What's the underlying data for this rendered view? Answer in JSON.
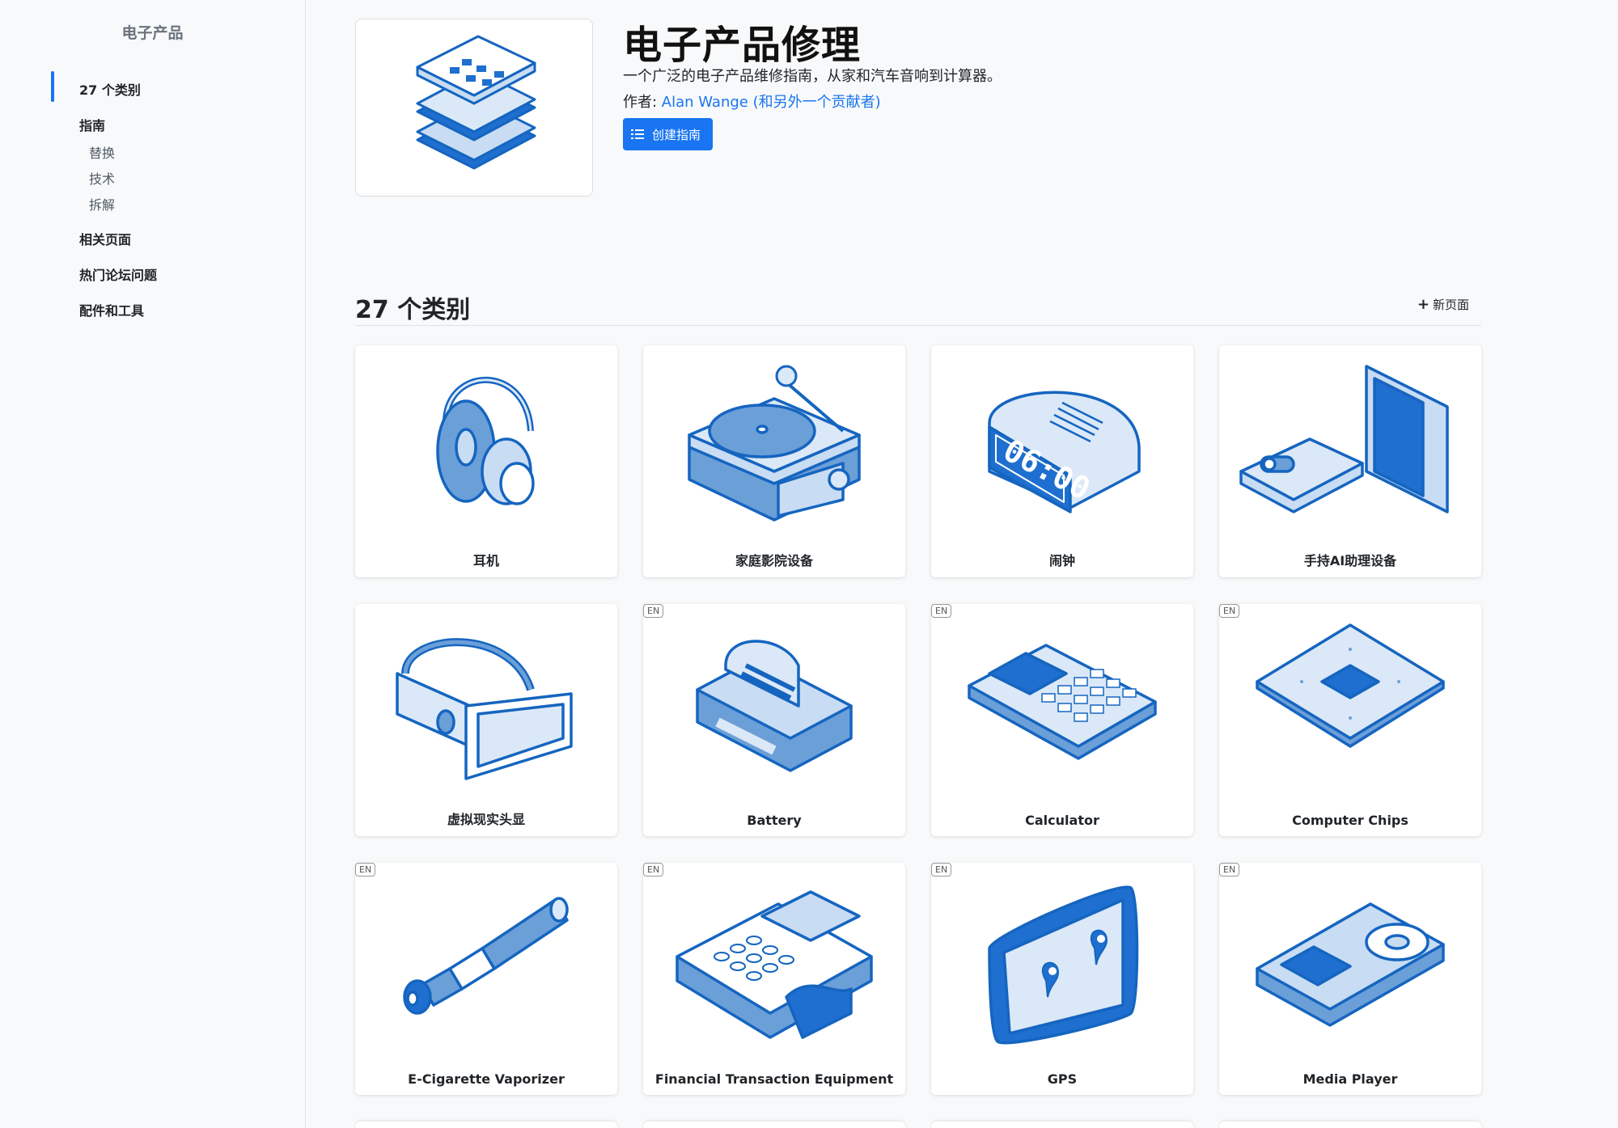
{
  "sidebar": {
    "title": "电子产品",
    "items": {
      "categories": "27 个类别",
      "guides": "指南",
      "sub": [
        "替换",
        "技术",
        "拆解"
      ],
      "related": "相关页面",
      "forum": "热门论坛问题",
      "parts": "配件和工具"
    }
  },
  "header": {
    "title": "电子产品修理",
    "description": "一个广泛的电子产品维修指南，从家和汽车音响到计算器。",
    "author_prefix": "作者: ",
    "author_link": "Alan Wange (和另外一个贡献者)",
    "create_button": "创建指南"
  },
  "section": {
    "title": "27 个类别",
    "new_page": "新页面"
  },
  "categories": [
    {
      "label": "耳机",
      "en": "",
      "icon": "headphones-icon"
    },
    {
      "label": "家庭影院设备",
      "en": "",
      "icon": "turntable-icon"
    },
    {
      "label": "闹钟",
      "en": "",
      "icon": "alarm-clock-icon"
    },
    {
      "label": "手持AI助理设备",
      "en": "",
      "icon": "ai-assistant-icon"
    },
    {
      "label": "虚拟现实头显",
      "en": "",
      "icon": "vr-headset-icon"
    },
    {
      "label": "Battery",
      "en": "EN",
      "icon": "battery-icon"
    },
    {
      "label": "Calculator",
      "en": "EN",
      "icon": "calculator-icon"
    },
    {
      "label": "Computer Chips",
      "en": "EN",
      "icon": "chip-icon"
    },
    {
      "label": "E-Cigarette Vaporizer",
      "en": "EN",
      "icon": "vaporizer-icon"
    },
    {
      "label": "Financial Transaction Equipment",
      "en": "EN",
      "icon": "payment-terminal-icon"
    },
    {
      "label": "GPS",
      "en": "EN",
      "icon": "gps-icon"
    },
    {
      "label": "Media Player",
      "en": "EN",
      "icon": "media-player-icon"
    }
  ],
  "colors": {
    "accent": "#1975f1",
    "icon_blue": "#1565c0",
    "icon_fill": "#c8dcf3"
  }
}
